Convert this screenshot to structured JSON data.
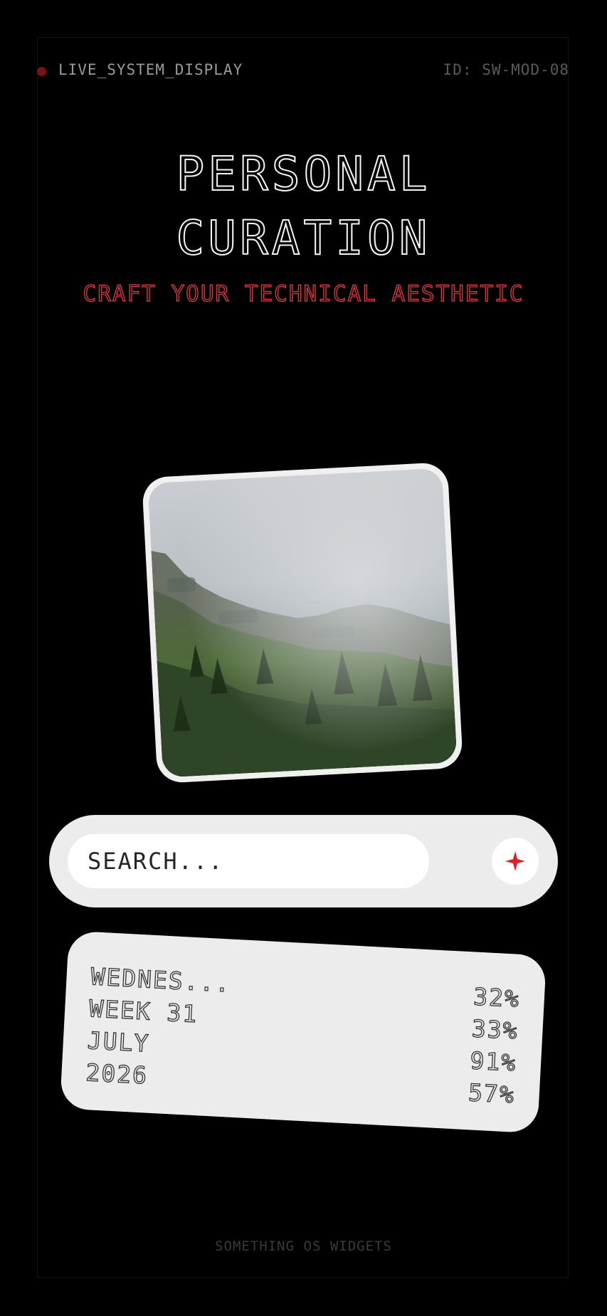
{
  "header": {
    "live_label": "LIVE_SYSTEM_DISPLAY",
    "system_id": "ID: SW-MOD-08"
  },
  "hero": {
    "title_line1": "PERSONAL",
    "title_line2": "CURATION",
    "subtitle": "CRAFT YOUR TECHNICAL AESTHETIC"
  },
  "photo": {
    "subject": "misty mountain forest",
    "icon": "image"
  },
  "search": {
    "placeholder": "SEARCH...",
    "action_icon": "sparkle-icon"
  },
  "stats": {
    "labels": [
      "WEDNES...",
      "WEEK 31",
      "JULY",
      "2026"
    ],
    "percents": [
      "32%",
      "33%",
      "91%",
      "57%"
    ]
  },
  "footer": {
    "text": "SOMETHING OS WIDGETS"
  },
  "colors": {
    "background": "#000000",
    "accent": "#e23c3c",
    "live_dot": "#7a1212",
    "card": "#ececec"
  }
}
